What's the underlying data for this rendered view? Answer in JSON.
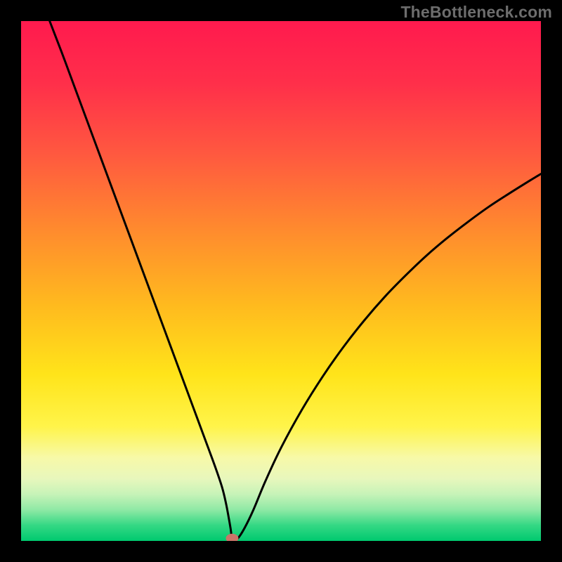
{
  "watermark": "TheBottleneck.com",
  "chart_data": {
    "type": "line",
    "title": "",
    "xlabel": "",
    "ylabel": "",
    "xlim": [
      0,
      100
    ],
    "ylim": [
      0,
      100
    ],
    "background": {
      "type": "vertical-gradient",
      "note": "heat-map gradient from red (top / bad) through orange, yellow, to green (bottom / good); band heights estimated from pixels",
      "stops": [
        {
          "y": 0,
          "color": "#ff1a4e"
        },
        {
          "y": 12,
          "color": "#ff2f4a"
        },
        {
          "y": 26,
          "color": "#ff5a3f"
        },
        {
          "y": 40,
          "color": "#ff8a2e"
        },
        {
          "y": 55,
          "color": "#ffbb1e"
        },
        {
          "y": 68,
          "color": "#ffe41a"
        },
        {
          "y": 78,
          "color": "#fff44a"
        },
        {
          "y": 84,
          "color": "#f7f9a8"
        },
        {
          "y": 88,
          "color": "#e8f7bc"
        },
        {
          "y": 91,
          "color": "#c7f3b8"
        },
        {
          "y": 94,
          "color": "#8fe9a5"
        },
        {
          "y": 97,
          "color": "#34d884"
        },
        {
          "y": 100,
          "color": "#00c96f"
        }
      ]
    },
    "series": [
      {
        "name": "bottleneck-curve",
        "color": "#000000",
        "note": "V-shaped curve; y is percent (0 at bottom / green). Minimum at x≈40.6, y≈0.",
        "x": [
          5.5,
          8,
          11,
          14,
          17,
          20,
          23,
          26,
          29,
          32,
          34,
          36,
          37.5,
          38.7,
          39.4,
          39.9,
          40.3,
          40.6,
          41.1,
          41.7,
          43,
          44.7,
          47,
          50,
          54,
          58,
          62,
          66,
          70,
          74,
          78,
          82,
          86,
          90,
          94,
          98,
          100
        ],
        "y": [
          100,
          93.5,
          85.4,
          77.3,
          69.2,
          61.1,
          53,
          44.9,
          36.8,
          28.7,
          23.3,
          17.9,
          13.8,
          10.2,
          7.3,
          4.7,
          2.4,
          0.5,
          0.5,
          0.5,
          2.5,
          6,
          11.5,
          17.9,
          25.2,
          31.6,
          37.3,
          42.4,
          47,
          51.1,
          54.9,
          58.3,
          61.4,
          64.3,
          66.9,
          69.4,
          70.6
        ]
      }
    ],
    "marker": {
      "name": "optimum-point",
      "approx_x": 40.6,
      "approx_y": 0.5,
      "color": "#cb7469",
      "shape": "rounded-oval"
    }
  }
}
